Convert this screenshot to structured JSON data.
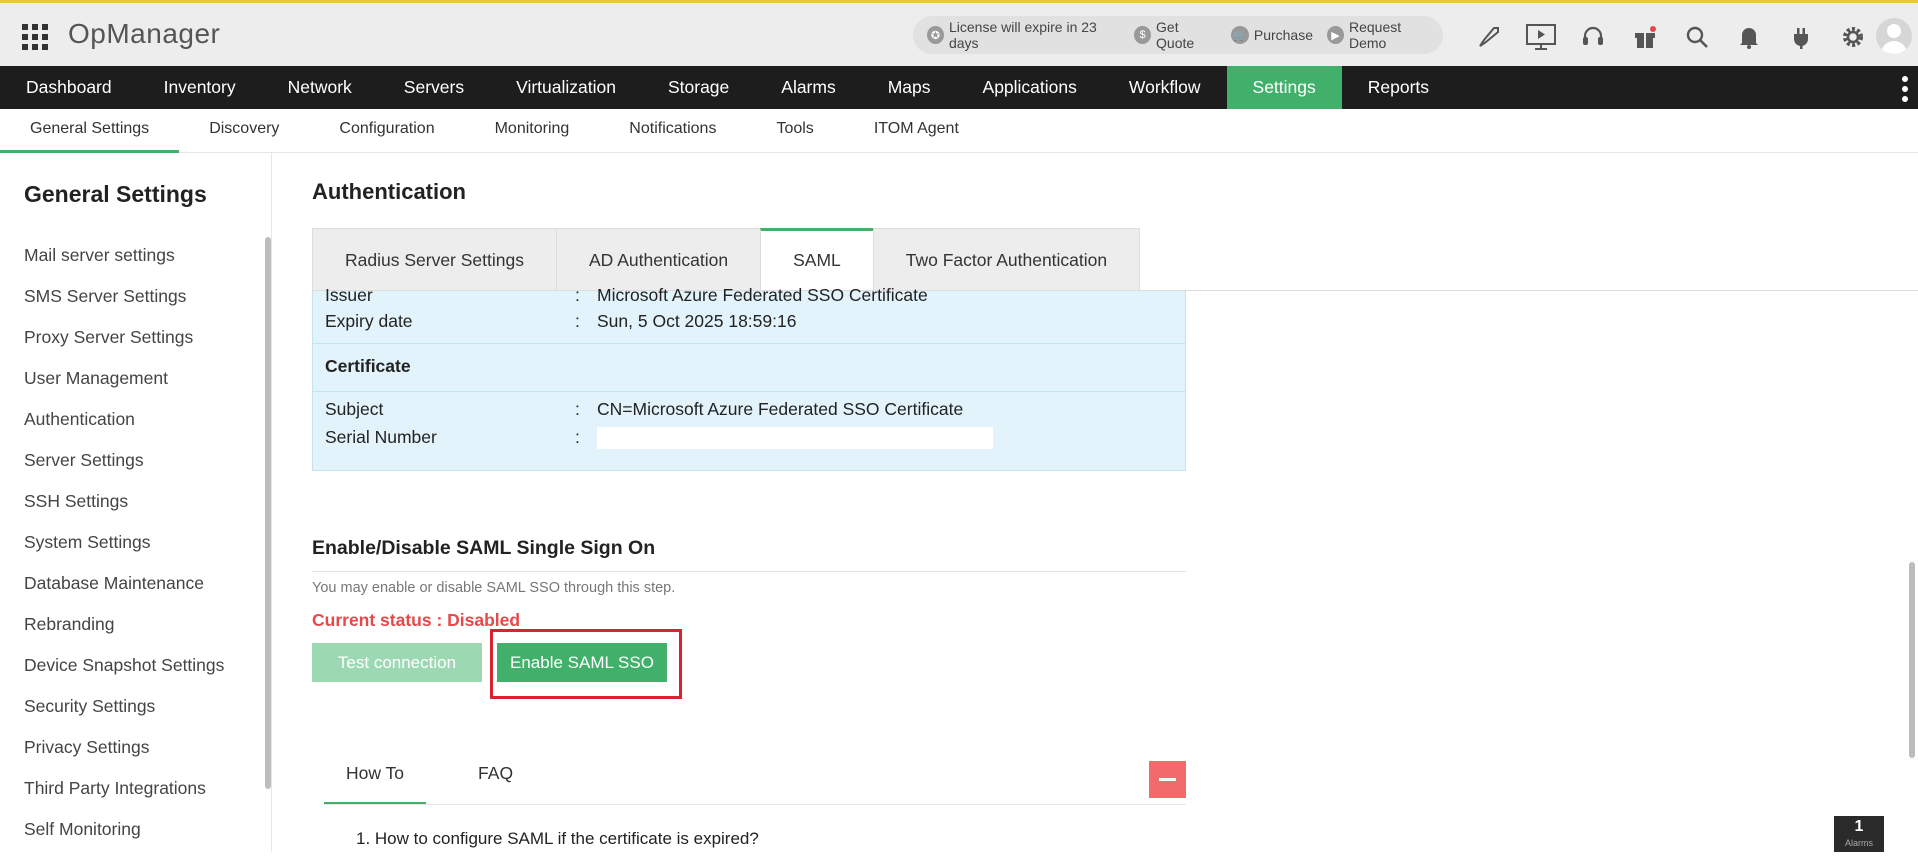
{
  "app": {
    "title": "OpManager"
  },
  "promo": {
    "license": "License will expire in 23 days",
    "quote": "Get Quote",
    "purchase": "Purchase",
    "demo": "Request Demo"
  },
  "top_icons": [
    "rocket-icon",
    "presentation-icon",
    "headset-icon",
    "gift-icon",
    "search-icon",
    "bell-icon",
    "plug-icon",
    "gear-icon"
  ],
  "main_nav": [
    {
      "label": "Dashboard",
      "active": false
    },
    {
      "label": "Inventory",
      "active": false
    },
    {
      "label": "Network",
      "active": false
    },
    {
      "label": "Servers",
      "active": false
    },
    {
      "label": "Virtualization",
      "active": false
    },
    {
      "label": "Storage",
      "active": false
    },
    {
      "label": "Alarms",
      "active": false
    },
    {
      "label": "Maps",
      "active": false
    },
    {
      "label": "Applications",
      "active": false
    },
    {
      "label": "Workflow",
      "active": false
    },
    {
      "label": "Settings",
      "active": true
    },
    {
      "label": "Reports",
      "active": false
    }
  ],
  "sub_nav": [
    {
      "label": "General Settings",
      "active": true
    },
    {
      "label": "Discovery",
      "active": false
    },
    {
      "label": "Configuration",
      "active": false
    },
    {
      "label": "Monitoring",
      "active": false
    },
    {
      "label": "Notifications",
      "active": false
    },
    {
      "label": "Tools",
      "active": false
    },
    {
      "label": "ITOM Agent",
      "active": false
    }
  ],
  "sidebar": {
    "title": "General Settings",
    "items": [
      "Mail server settings",
      "SMS Server Settings",
      "Proxy Server Settings",
      "User Management",
      "Authentication",
      "Server Settings",
      "SSH Settings",
      "System Settings",
      "Database Maintenance",
      "Rebranding",
      "Device Snapshot Settings",
      "Security Settings",
      "Privacy Settings",
      "Third Party Integrations",
      "Self Monitoring"
    ]
  },
  "page": {
    "title": "Authentication",
    "tabs": [
      {
        "label": "Radius Server Settings",
        "active": false
      },
      {
        "label": "AD Authentication",
        "active": false
      },
      {
        "label": "SAML",
        "active": true
      },
      {
        "label": "Two Factor Authentication",
        "active": false
      }
    ]
  },
  "cert": {
    "issuer_label": "Issuer",
    "issuer_value": "Microsoft Azure Federated SSO Certificate",
    "expiry_label": "Expiry date",
    "expiry_value": "Sun, 5 Oct 2025 18:59:16",
    "section_label": "Certificate",
    "subject_label": "Subject",
    "subject_value": "CN=Microsoft Azure Federated SSO Certificate",
    "serial_label": "Serial Number",
    "sep": ":"
  },
  "sso": {
    "title": "Enable/Disable SAML Single Sign On",
    "desc": "You may enable or disable SAML SSO through this step.",
    "status": "Current status : Disabled",
    "test_btn": "Test connection",
    "enable_btn": "Enable SAML SSO"
  },
  "help": {
    "tabs": [
      {
        "label": "How To",
        "active": true
      },
      {
        "label": "FAQ",
        "active": false
      }
    ],
    "question": "1. How to configure SAML if the certificate is expired?"
  },
  "alarm_badge": {
    "count": "1",
    "label": "Alarms"
  },
  "colors": {
    "accent": "#41b06a",
    "danger": "#e6494c",
    "nav_bg": "#1d1d1d",
    "cert_bg": "#e3f3fb"
  }
}
